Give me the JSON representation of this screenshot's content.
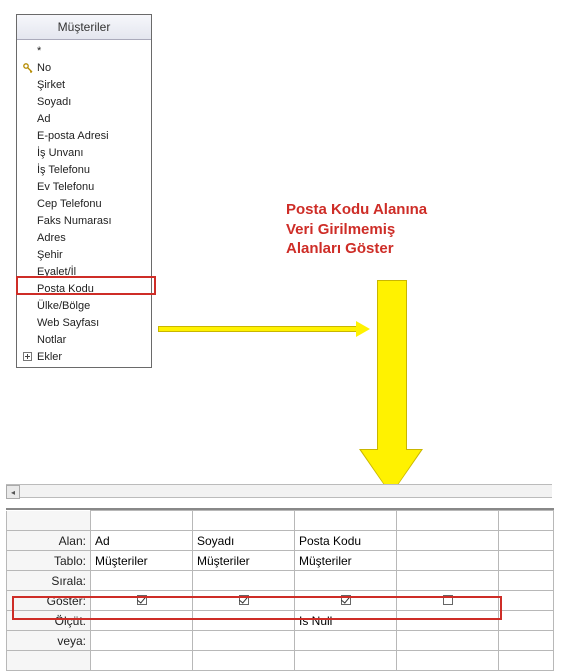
{
  "field_list": {
    "title": "Müşteriler",
    "fields": [
      {
        "label": "*",
        "icon": "none"
      },
      {
        "label": "No",
        "icon": "key"
      },
      {
        "label": "Şirket",
        "icon": "none"
      },
      {
        "label": "Soyadı",
        "icon": "none"
      },
      {
        "label": "Ad",
        "icon": "none"
      },
      {
        "label": "E-posta Adresi",
        "icon": "none"
      },
      {
        "label": "İş Unvanı",
        "icon": "none"
      },
      {
        "label": "İş Telefonu",
        "icon": "none"
      },
      {
        "label": "Ev Telefonu",
        "icon": "none"
      },
      {
        "label": "Cep Telefonu",
        "icon": "none"
      },
      {
        "label": "Faks Numarası",
        "icon": "none"
      },
      {
        "label": "Adres",
        "icon": "none"
      },
      {
        "label": "Şehir",
        "icon": "none"
      },
      {
        "label": "Eyalet/İl",
        "icon": "none"
      },
      {
        "label": "Posta Kodu",
        "icon": "none",
        "highlighted": true
      },
      {
        "label": "Ülke/Bölge",
        "icon": "none"
      },
      {
        "label": "Web Sayfası",
        "icon": "none"
      },
      {
        "label": "Notlar",
        "icon": "none"
      },
      {
        "label": "Ekler",
        "icon": "expand"
      }
    ]
  },
  "annotation": {
    "line1": "Posta Kodu Alanına",
    "line2": "Veri Girilmemiş",
    "line3": "Alanları Göster"
  },
  "grid": {
    "row_labels": {
      "alan": "Alan:",
      "tablo": "Tablo:",
      "sirala": "Sırala:",
      "goster": "Göster:",
      "olcut": "Ölçüt:",
      "veya": "veya:"
    },
    "columns": [
      {
        "alan": "Ad",
        "tablo": "Müşteriler",
        "sirala": "",
        "goster": true,
        "olcut": "",
        "veya": ""
      },
      {
        "alan": "Soyadı",
        "tablo": "Müşteriler",
        "sirala": "",
        "goster": true,
        "olcut": "",
        "veya": ""
      },
      {
        "alan": "Posta Kodu",
        "tablo": "Müşteriler",
        "sirala": "",
        "goster": true,
        "olcut": "Is Null",
        "veya": ""
      },
      {
        "alan": "",
        "tablo": "",
        "sirala": "",
        "goster": false,
        "olcut": "",
        "veya": ""
      }
    ]
  },
  "colors": {
    "highlight": "#ce2d27",
    "arrow": "#fff200"
  }
}
